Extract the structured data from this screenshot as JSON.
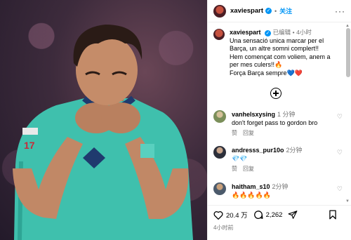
{
  "header": {
    "username": "xaviespart",
    "follow_label": "关注",
    "separator": "•",
    "more": "···"
  },
  "caption": {
    "username": "xaviespart",
    "edited": "已编辑",
    "separator": "•",
    "time": "4小时",
    "lines": [
      "Una sensació unica marcar per el",
      "Barça, un altre somni complert!!",
      "Hem començat com voliem, anem a",
      "per mes culers!!🔥",
      "Força Barça sempre"
    ],
    "hearts": [
      "💙",
      "❤️"
    ]
  },
  "comments": [
    {
      "username": "vanhelsxysing",
      "time": "1 分钟",
      "text": "don't forget pass to gordon bro",
      "like": "赞",
      "reply": "回复"
    },
    {
      "username": "andresss_pur10o",
      "time": "2分钟",
      "text": "💎💎",
      "like": "赞",
      "reply": "回复"
    },
    {
      "username": "haitham_s10",
      "time": "2分钟",
      "text": "🔥🔥🔥🔥🔥",
      "like": "赞",
      "reply": "回复"
    }
  ],
  "footer": {
    "likes": "20.4 万",
    "comments": "2,262",
    "time": "4小时前"
  },
  "colors": {
    "accent": "#0095f6",
    "jersey": "#3fc0ad",
    "muted": "#737373"
  },
  "icons": [
    "verified-icon",
    "more-icon",
    "add-comment-icon",
    "heart-icon",
    "comment-icon",
    "share-icon",
    "bookmark-icon"
  ]
}
